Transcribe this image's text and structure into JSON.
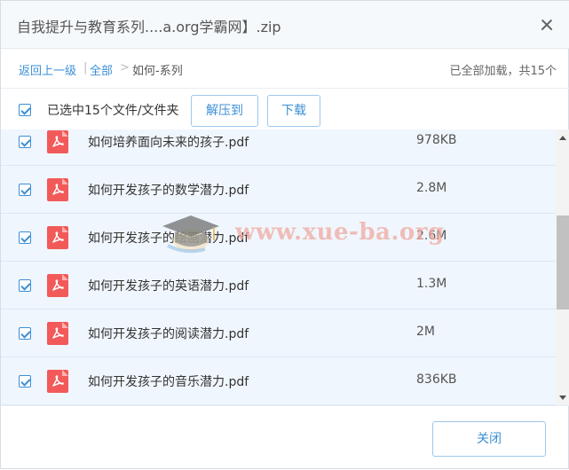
{
  "dialog": {
    "title": "自我提升与教育系列....a.org学霸网】.zip",
    "close_icon": "close-icon"
  },
  "breadcrumb": {
    "back": "返回上一级",
    "separator1": "|",
    "all": "全部",
    "separator2": ">",
    "current": "如何-系列"
  },
  "status": "已全部加载，共15个",
  "selection": {
    "label": "已选中15个文件/文件夹",
    "extract_button": "解压到",
    "download_button": "下载"
  },
  "files": [
    {
      "name": "如何培养面向未来的孩子.pdf",
      "size": "978KB",
      "icon": "pdf-icon"
    },
    {
      "name": "如何开发孩子的数学潜力.pdf",
      "size": "2.8M",
      "icon": "pdf-icon"
    },
    {
      "name": "如何开发孩子的绘画潜力.pdf",
      "size": "2.6M",
      "icon": "pdf-icon"
    },
    {
      "name": "如何开发孩子的英语潜力.pdf",
      "size": "1.3M",
      "icon": "pdf-icon"
    },
    {
      "name": "如何开发孩子的阅读潜力.pdf",
      "size": "2M",
      "icon": "pdf-icon"
    },
    {
      "name": "如何开发孩子的音乐潜力.pdf",
      "size": "836KB",
      "icon": "pdf-icon"
    }
  ],
  "watermark": {
    "text": "www.xue-ba.org"
  },
  "footer": {
    "close_button": "关闭"
  },
  "colors": {
    "accent": "#3b8fd6",
    "row_bg": "#f0f6fd",
    "pdf_red": "#f25a5a"
  }
}
